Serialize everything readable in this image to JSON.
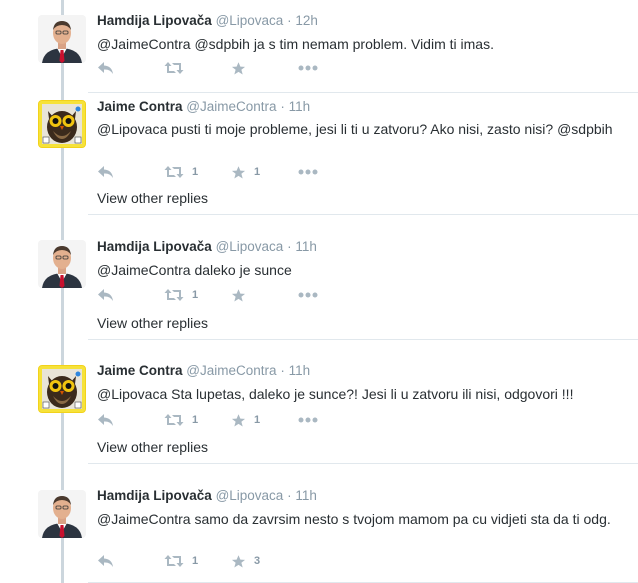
{
  "tweets": [
    {
      "name": "Hamdija Lipovača",
      "handle": "@Lipovaca",
      "time": "12h",
      "text": "@JaimeContra @sdpbih ja s tim nemam problem. Vidim ti imas.",
      "retweets": "",
      "likes": "",
      "other_replies": ""
    },
    {
      "name": "Jaime Contra",
      "handle": "@JaimeContra",
      "time": "11h",
      "text": "@Lipovaca pusti ti moje probleme, jesi li ti u zatvoru?  Ako nisi, zasto nisi? @sdpbih",
      "retweets": "1",
      "likes": "1",
      "other_replies": "View other replies"
    },
    {
      "name": "Hamdija Lipovača",
      "handle": "@Lipovaca",
      "time": "11h",
      "text": "@JaimeContra daleko je sunce",
      "retweets": "1",
      "likes": "",
      "other_replies": "View other replies"
    },
    {
      "name": "Jaime Contra",
      "handle": "@JaimeContra",
      "time": "11h",
      "text": "@Lipovaca Sta lupetas, daleko je sunce?! Jesi li u zatvoru ili nisi, odgovori !!!",
      "retweets": "1",
      "likes": "1",
      "other_replies": "View other replies"
    },
    {
      "name": "Hamdija Lipovača",
      "handle": "@Lipovaca",
      "time": "11h",
      "text": "@JaimeContra samo da zavrsim nesto s tvojom mamom pa cu vidjeti sta da ti odg.",
      "retweets": "1",
      "likes": "3",
      "other_replies": ""
    }
  ],
  "separator": "·",
  "icons": {
    "reply": "reply-icon",
    "retweet": "retweet-icon",
    "like": "star-icon",
    "more": "more-icon"
  },
  "colors": {
    "text": "#292f33",
    "muted": "#8899a6",
    "icon": "#aab8c2",
    "thread_line": "#ccd6dd",
    "divider": "#e1e8ed"
  }
}
